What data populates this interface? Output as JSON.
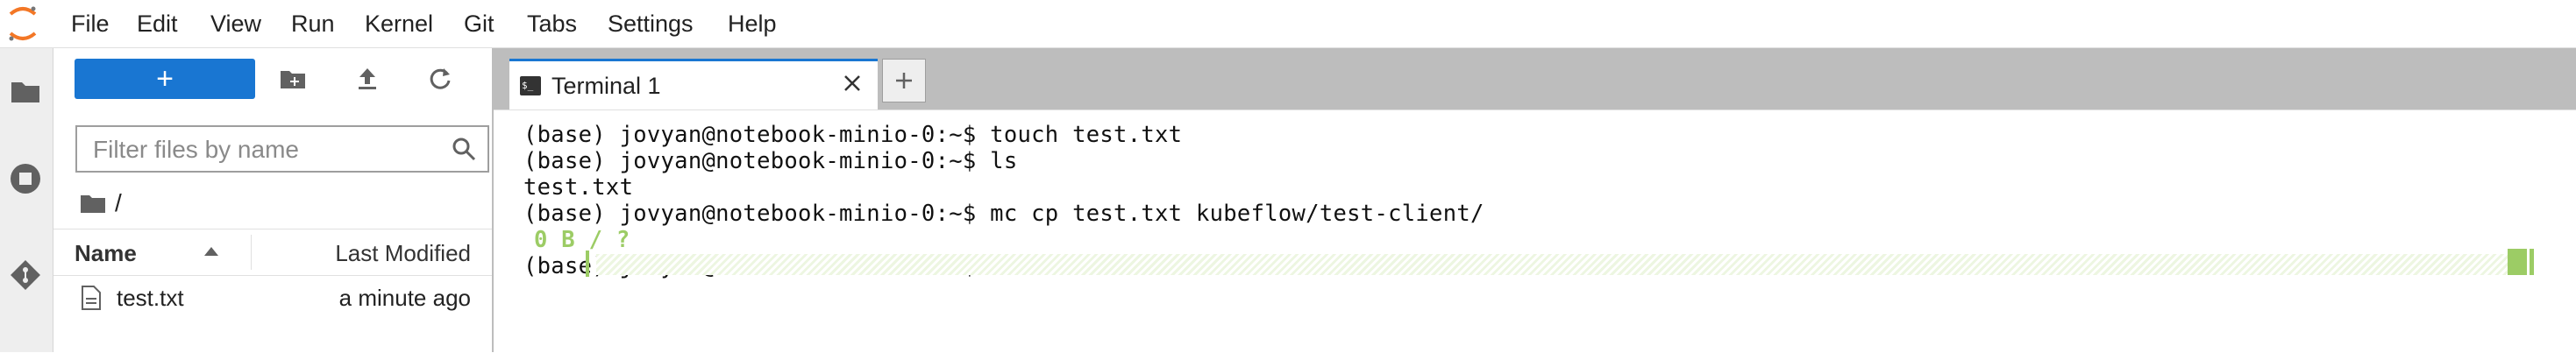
{
  "menubar": {
    "items": [
      "File",
      "Edit",
      "View",
      "Run",
      "Kernel",
      "Git",
      "Tabs",
      "Settings",
      "Help"
    ]
  },
  "activity": {
    "icons": [
      "folder-icon",
      "stop-circle-icon",
      "git-icon"
    ]
  },
  "filebrowser": {
    "new_button_label": "+",
    "filter_placeholder": "Filter files by name",
    "breadcrumb": "/",
    "columns": {
      "name": "Name",
      "modified": "Last Modified"
    },
    "files": [
      {
        "name": "test.txt",
        "modified": "a minute ago"
      }
    ]
  },
  "tabs": {
    "active_title": "Terminal 1",
    "new_tab_label": "+"
  },
  "terminal": {
    "lines": [
      "(base) jovyan@notebook-minio-0:~$ touch test.txt",
      "(base) jovyan@notebook-minio-0:~$ ls",
      "test.txt",
      "(base) jovyan@notebook-minio-0:~$ mc cp test.txt kubeflow/test-client/",
      "0 B / ?",
      "(base) jovyan@notebook-minio-0:~$"
    ],
    "progress_color": "#9ccc65"
  },
  "colors": {
    "accent": "#1976d2",
    "tabbar": "#bdbdbd"
  }
}
